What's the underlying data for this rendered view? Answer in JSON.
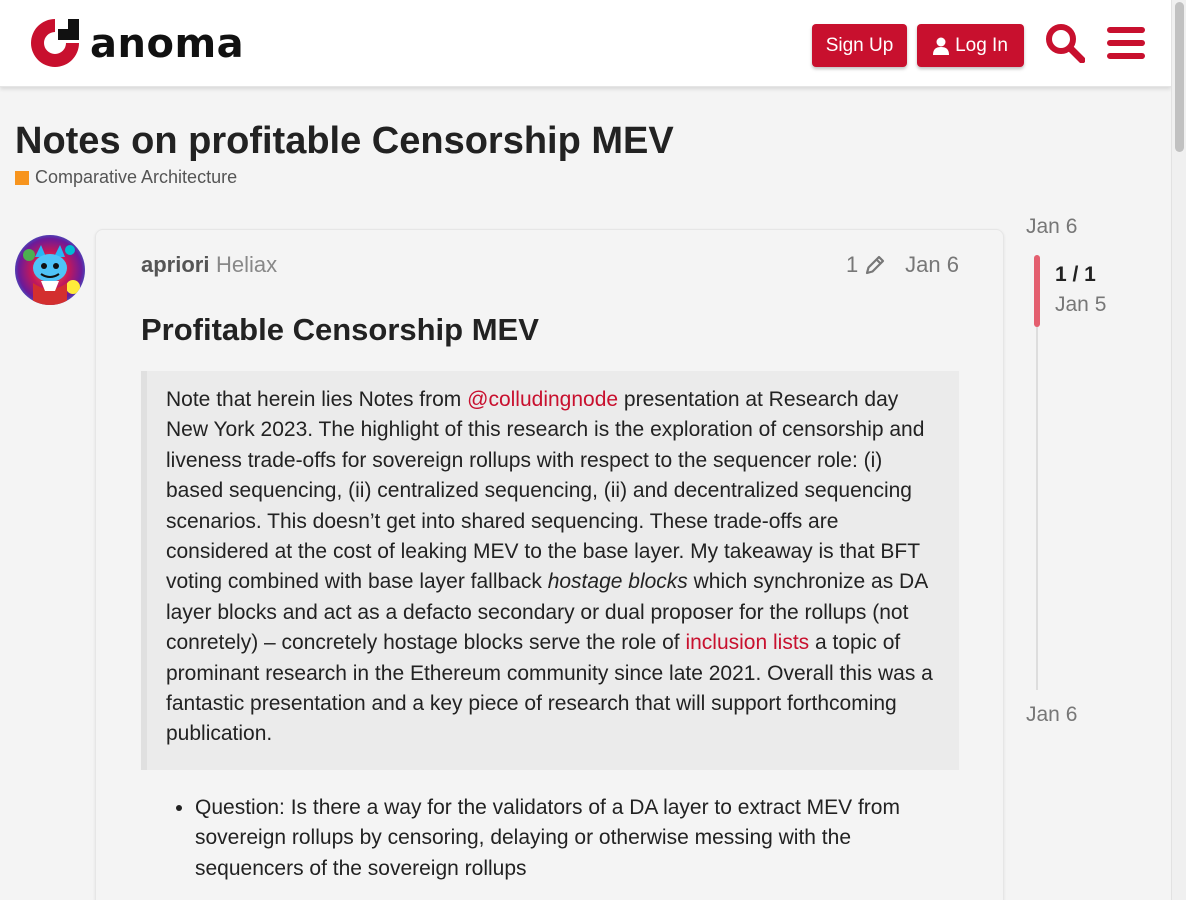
{
  "header": {
    "brand": "anoma",
    "signup_label": "Sign Up",
    "login_label": "Log In",
    "accent_color": "#c8102e"
  },
  "topic": {
    "title": "Notes on profitable Censorship MEV",
    "category": "Comparative Architecture",
    "category_color": "#f7941d"
  },
  "post": {
    "username": "apriori",
    "user_title": "Heliax",
    "edit_count": "1",
    "date": "Jan 6",
    "heading": "Profitable Censorship MEV",
    "quote": {
      "part1": "Note that herein lies Notes from ",
      "mention": "@colludingnode",
      "part2": " presentation at Research day New York 2023. The highlight of this research is the exploration of censorship and liveness trade-offs for sovereign rollups with respect to the sequencer role: (i) based sequencing, (ii) centralized sequencing, (ii) and decentralized sequencing scenarios. This doesn’t get into shared sequencing. These trade-offs are considered at the cost of leaking MEV to the base layer. My takeaway is that BFT voting combined with base layer fallback ",
      "emphasis": "hostage blocks",
      "part3": " which synchronize as DA layer blocks and act as a defacto secondary or dual proposer for the rollups (not conretely) – concretely hostage blocks serve the role of ",
      "link": "inclusion lists",
      "part4": " a topic of prominant research in the Ethereum community since late 2021. Overall this was a fantastic presentation and a key piece of research that will support forthcoming publication."
    },
    "bullets": [
      "Question: Is there a way for the validators of a DA layer to extract MEV from sovereign rollups by censoring, delaying or otherwise messing with the sequencers of the sovereign rollups"
    ]
  },
  "timeline": {
    "top_date": "Jan 6",
    "position": "1 / 1",
    "position_date": "Jan 5",
    "bottom_date": "Jan 6"
  },
  "icons": [
    "anoma-logo-icon",
    "user-icon",
    "search-icon",
    "hamburger-menu-icon",
    "pencil-icon"
  ]
}
